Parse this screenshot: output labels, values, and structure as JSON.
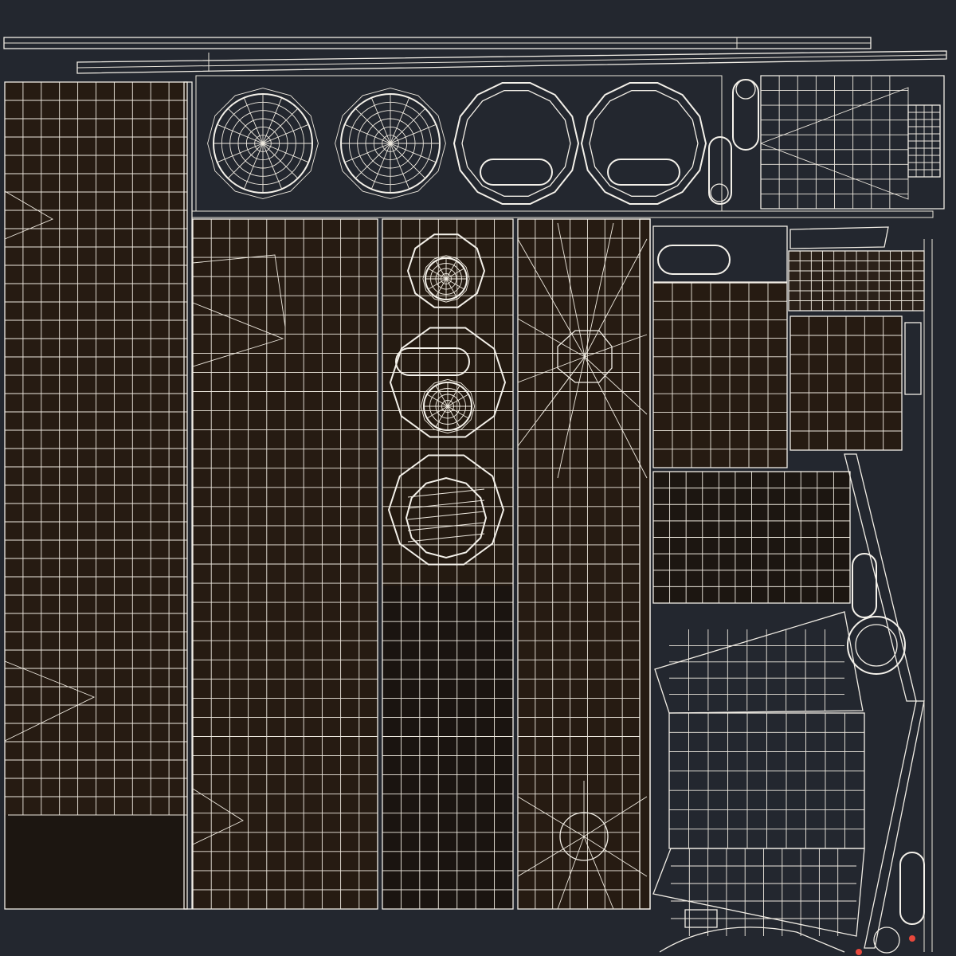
{
  "colors": {
    "background": "#23272f",
    "panel_fill": "#261b12",
    "panel_fill_dark": "#1c140c",
    "panel_fill_black": "#15120e",
    "wire": "#ece7dd",
    "island_grey": "#2f343d",
    "center_hub": "#3b4049",
    "highlight_red": "#e8483c"
  },
  "icons": {
    "hub": "octagon-hub-icon",
    "radial": "radial-wheel-icon",
    "capsule": "capsule-slot-icon"
  }
}
